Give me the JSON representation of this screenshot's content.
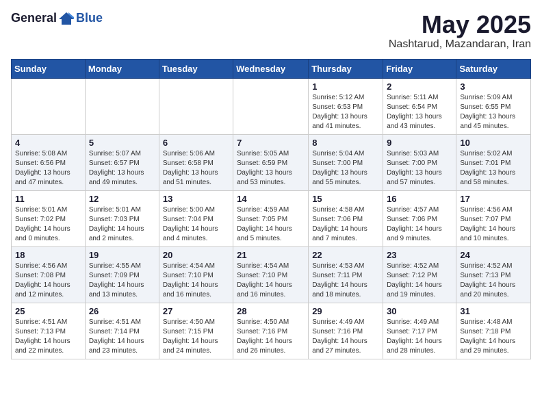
{
  "header": {
    "logo_general": "General",
    "logo_blue": "Blue",
    "month_title": "May 2025",
    "subtitle": "Nashtarud, Mazandaran, Iran"
  },
  "days_of_week": [
    "Sunday",
    "Monday",
    "Tuesday",
    "Wednesday",
    "Thursday",
    "Friday",
    "Saturday"
  ],
  "weeks": [
    [
      {
        "day": "",
        "content": ""
      },
      {
        "day": "",
        "content": ""
      },
      {
        "day": "",
        "content": ""
      },
      {
        "day": "",
        "content": ""
      },
      {
        "day": "1",
        "content": "Sunrise: 5:12 AM\nSunset: 6:53 PM\nDaylight: 13 hours\nand 41 minutes."
      },
      {
        "day": "2",
        "content": "Sunrise: 5:11 AM\nSunset: 6:54 PM\nDaylight: 13 hours\nand 43 minutes."
      },
      {
        "day": "3",
        "content": "Sunrise: 5:09 AM\nSunset: 6:55 PM\nDaylight: 13 hours\nand 45 minutes."
      }
    ],
    [
      {
        "day": "4",
        "content": "Sunrise: 5:08 AM\nSunset: 6:56 PM\nDaylight: 13 hours\nand 47 minutes."
      },
      {
        "day": "5",
        "content": "Sunrise: 5:07 AM\nSunset: 6:57 PM\nDaylight: 13 hours\nand 49 minutes."
      },
      {
        "day": "6",
        "content": "Sunrise: 5:06 AM\nSunset: 6:58 PM\nDaylight: 13 hours\nand 51 minutes."
      },
      {
        "day": "7",
        "content": "Sunrise: 5:05 AM\nSunset: 6:59 PM\nDaylight: 13 hours\nand 53 minutes."
      },
      {
        "day": "8",
        "content": "Sunrise: 5:04 AM\nSunset: 7:00 PM\nDaylight: 13 hours\nand 55 minutes."
      },
      {
        "day": "9",
        "content": "Sunrise: 5:03 AM\nSunset: 7:00 PM\nDaylight: 13 hours\nand 57 minutes."
      },
      {
        "day": "10",
        "content": "Sunrise: 5:02 AM\nSunset: 7:01 PM\nDaylight: 13 hours\nand 58 minutes."
      }
    ],
    [
      {
        "day": "11",
        "content": "Sunrise: 5:01 AM\nSunset: 7:02 PM\nDaylight: 14 hours\nand 0 minutes."
      },
      {
        "day": "12",
        "content": "Sunrise: 5:01 AM\nSunset: 7:03 PM\nDaylight: 14 hours\nand 2 minutes."
      },
      {
        "day": "13",
        "content": "Sunrise: 5:00 AM\nSunset: 7:04 PM\nDaylight: 14 hours\nand 4 minutes."
      },
      {
        "day": "14",
        "content": "Sunrise: 4:59 AM\nSunset: 7:05 PM\nDaylight: 14 hours\nand 5 minutes."
      },
      {
        "day": "15",
        "content": "Sunrise: 4:58 AM\nSunset: 7:06 PM\nDaylight: 14 hours\nand 7 minutes."
      },
      {
        "day": "16",
        "content": "Sunrise: 4:57 AM\nSunset: 7:06 PM\nDaylight: 14 hours\nand 9 minutes."
      },
      {
        "day": "17",
        "content": "Sunrise: 4:56 AM\nSunset: 7:07 PM\nDaylight: 14 hours\nand 10 minutes."
      }
    ],
    [
      {
        "day": "18",
        "content": "Sunrise: 4:56 AM\nSunset: 7:08 PM\nDaylight: 14 hours\nand 12 minutes."
      },
      {
        "day": "19",
        "content": "Sunrise: 4:55 AM\nSunset: 7:09 PM\nDaylight: 14 hours\nand 13 minutes."
      },
      {
        "day": "20",
        "content": "Sunrise: 4:54 AM\nSunset: 7:10 PM\nDaylight: 14 hours\nand 16 minutes."
      },
      {
        "day": "21",
        "content": "Sunrise: 4:54 AM\nSunset: 7:10 PM\nDaylight: 14 hours\nand 16 minutes."
      },
      {
        "day": "22",
        "content": "Sunrise: 4:53 AM\nSunset: 7:11 PM\nDaylight: 14 hours\nand 18 minutes."
      },
      {
        "day": "23",
        "content": "Sunrise: 4:52 AM\nSunset: 7:12 PM\nDaylight: 14 hours\nand 19 minutes."
      },
      {
        "day": "24",
        "content": "Sunrise: 4:52 AM\nSunset: 7:13 PM\nDaylight: 14 hours\nand 20 minutes."
      }
    ],
    [
      {
        "day": "25",
        "content": "Sunrise: 4:51 AM\nSunset: 7:13 PM\nDaylight: 14 hours\nand 22 minutes."
      },
      {
        "day": "26",
        "content": "Sunrise: 4:51 AM\nSunset: 7:14 PM\nDaylight: 14 hours\nand 23 minutes."
      },
      {
        "day": "27",
        "content": "Sunrise: 4:50 AM\nSunset: 7:15 PM\nDaylight: 14 hours\nand 24 minutes."
      },
      {
        "day": "28",
        "content": "Sunrise: 4:50 AM\nSunset: 7:16 PM\nDaylight: 14 hours\nand 26 minutes."
      },
      {
        "day": "29",
        "content": "Sunrise: 4:49 AM\nSunset: 7:16 PM\nDaylight: 14 hours\nand 27 minutes."
      },
      {
        "day": "30",
        "content": "Sunrise: 4:49 AM\nSunset: 7:17 PM\nDaylight: 14 hours\nand 28 minutes."
      },
      {
        "day": "31",
        "content": "Sunrise: 4:48 AM\nSunset: 7:18 PM\nDaylight: 14 hours\nand 29 minutes."
      }
    ]
  ]
}
